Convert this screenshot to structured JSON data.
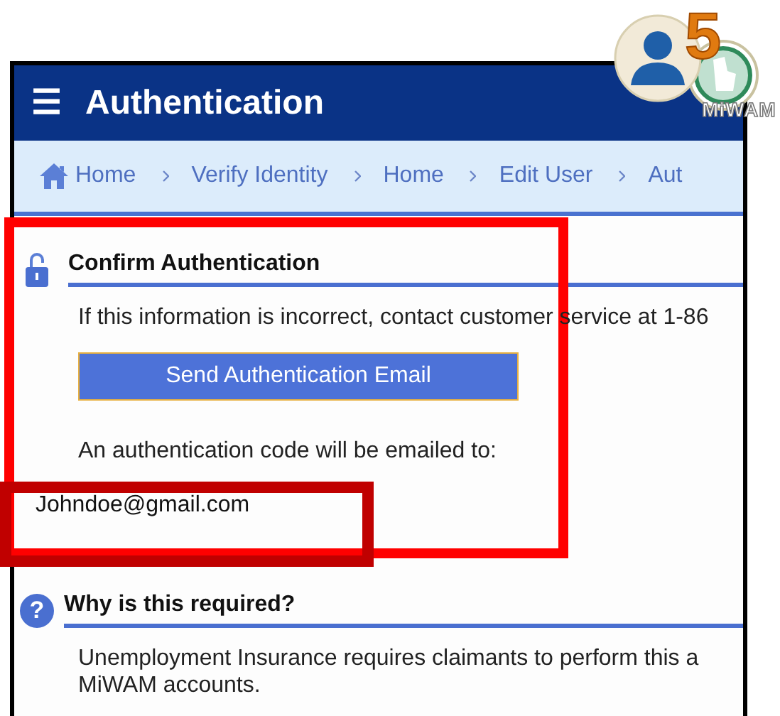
{
  "header": {
    "menu_icon": "☰",
    "title": "Authentication"
  },
  "logo": {
    "digit": "5",
    "text": "MiWAM"
  },
  "breadcrumbs": [
    {
      "label": "Home",
      "kind": "home"
    },
    {
      "label": "Verify Identity",
      "kind": "link"
    },
    {
      "label": "Home",
      "kind": "link"
    },
    {
      "label": "Edit User",
      "kind": "link"
    },
    {
      "label": "Aut",
      "kind": "link"
    }
  ],
  "confirm_section": {
    "heading": "Confirm Authentication",
    "info": "If this information is incorrect, contact customer service at 1-86",
    "button": "Send Authentication Email",
    "note": "An authentication code will be emailed to:",
    "email": "Johndoe@gmail.com"
  },
  "why_section": {
    "icon": "?",
    "heading": "Why is this required?",
    "lines": [
      "Unemployment Insurance requires claimants to perform this a",
      "MiWAM accounts."
    ]
  },
  "annotations": [
    {
      "kind": "section",
      "color": "#ff0000"
    },
    {
      "kind": "field",
      "color": "#c00000"
    }
  ]
}
